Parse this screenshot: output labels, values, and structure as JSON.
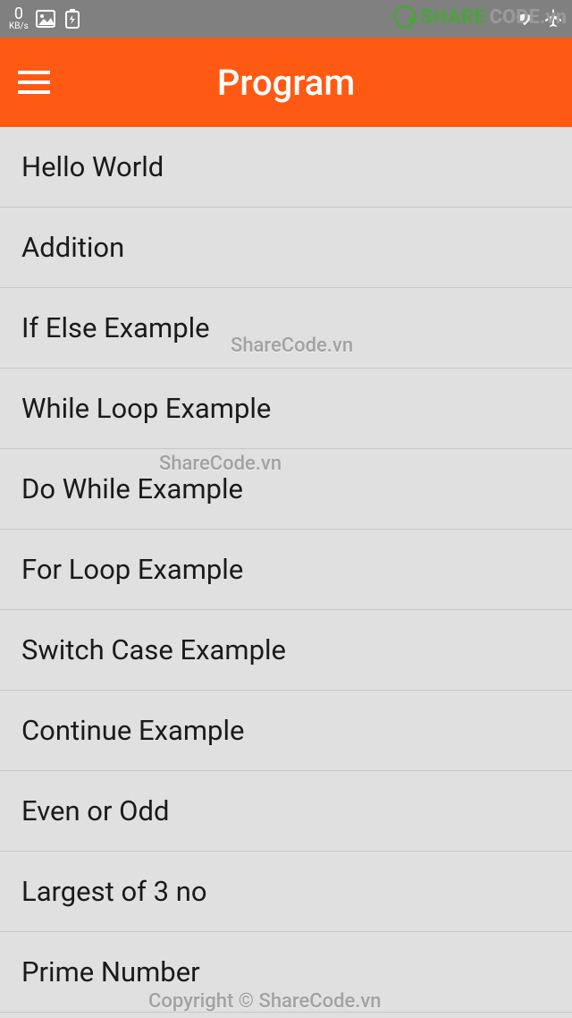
{
  "status_bar": {
    "kbs_value": "0",
    "kbs_label": "KB/s"
  },
  "app_bar": {
    "title": "Program"
  },
  "list": {
    "items": [
      {
        "label": "Hello World"
      },
      {
        "label": "Addition"
      },
      {
        "label": "If Else Example"
      },
      {
        "label": "While Loop Example"
      },
      {
        "label": "Do While Example"
      },
      {
        "label": "For Loop Example"
      },
      {
        "label": "Switch Case Example"
      },
      {
        "label": "Continue Example"
      },
      {
        "label": "Even or Odd"
      },
      {
        "label": "Largest of 3 no"
      },
      {
        "label": "Prime Number"
      }
    ]
  },
  "watermarks": {
    "text1": "ShareCode.vn",
    "text2": "ShareCode.vn",
    "copyright": "Copyright © ShareCode.vn",
    "logo_share": "SHARE",
    "logo_code": "CODE.vn"
  }
}
